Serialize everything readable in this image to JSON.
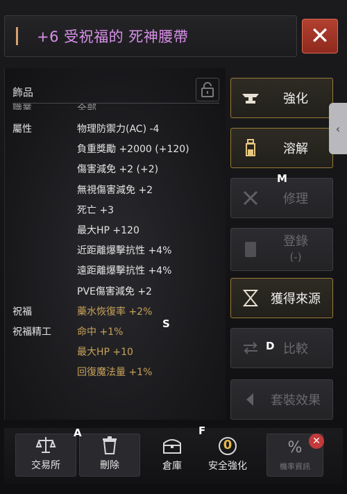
{
  "title": {
    "text": "+6 受祝福的 死神腰帶"
  },
  "category": "飾品",
  "cut_row": {
    "left": "職業",
    "right": "全部"
  },
  "stat_rows": [
    {
      "label": "屬性",
      "value": "物理防禦力(AC) -4",
      "color": "white"
    },
    {
      "label": "",
      "value": "負重獎勵 +2000 (+120)",
      "color": "white"
    },
    {
      "label": "",
      "value": "傷害減免 +2 (+2)",
      "color": "white"
    },
    {
      "label": "",
      "value": "無視傷害減免 +2",
      "color": "white"
    },
    {
      "label": "",
      "value": "死亡 +3",
      "color": "white"
    },
    {
      "label": "",
      "value": "最大HP +120",
      "color": "white"
    },
    {
      "label": "",
      "value": "近距離爆擊抗性 +4%",
      "color": "white"
    },
    {
      "label": "",
      "value": "遠距離爆擊抗性 +4%",
      "color": "white"
    },
    {
      "label": "",
      "value": "PVE傷害減免 +2",
      "color": "white"
    },
    {
      "label": "祝福",
      "value": "藥水恢復率 +2%",
      "color": "gold"
    },
    {
      "label": "祝福精工",
      "value": "命中 +1%",
      "color": "gold"
    },
    {
      "label": "",
      "value": "最大HP +10",
      "color": "gold"
    },
    {
      "label": "",
      "value": "回復魔法量 +1%",
      "color": "gold"
    }
  ],
  "actions": {
    "enhance": "強化",
    "dissolve": "溶解",
    "repair": "修理",
    "register": "登錄",
    "register_count": "(-)",
    "source": "獲得來源",
    "compare": "比較",
    "set_effect": "套裝效果"
  },
  "bottom": {
    "exchange": "交易所",
    "delete": "刪除",
    "warehouse": "倉庫",
    "safe_enhance": "安全強化",
    "safe_enhance_badge": "0",
    "prob_info": "機率資訊"
  },
  "markers": {
    "a": "A",
    "f": "F",
    "m": "M",
    "d": "D",
    "s": "S"
  },
  "colors": {
    "title": "#d890e8",
    "gold_text": "#c8a25a",
    "close_bg": "#b2402f",
    "active_border": "#9b7b38"
  }
}
